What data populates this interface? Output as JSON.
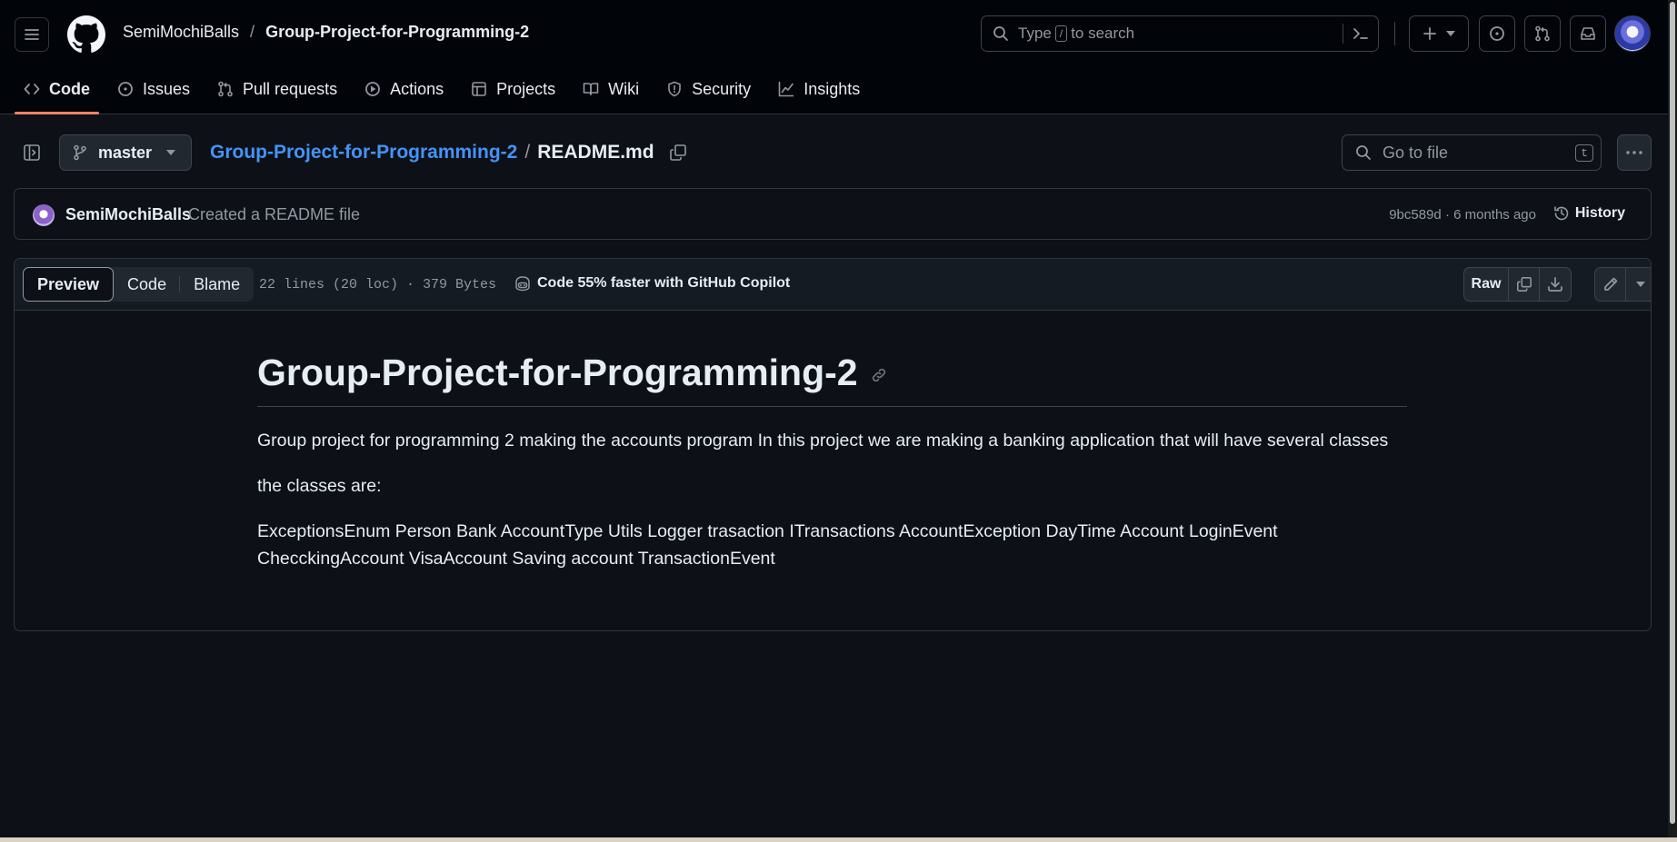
{
  "header": {
    "owner": "SemiMochiBalls",
    "separator": "/",
    "repo": "Group-Project-for-Programming-2",
    "search": {
      "prefix": "Type",
      "key": "/",
      "suffix": "to search"
    },
    "icons": {
      "menu": "hamburger-icon",
      "logo": "github-logo-icon",
      "command": "command-palette-icon",
      "create": "plus-icon",
      "issues": "issue-opened-icon",
      "pulls": "git-pull-request-icon",
      "inbox": "inbox-icon"
    }
  },
  "tabs": [
    {
      "label": "Code",
      "icon": "code-icon",
      "active": true
    },
    {
      "label": "Issues",
      "icon": "issue-opened-icon"
    },
    {
      "label": "Pull requests",
      "icon": "git-pull-request-icon"
    },
    {
      "label": "Actions",
      "icon": "play-icon"
    },
    {
      "label": "Projects",
      "icon": "table-icon"
    },
    {
      "label": "Wiki",
      "icon": "book-icon"
    },
    {
      "label": "Security",
      "icon": "shield-icon"
    },
    {
      "label": "Insights",
      "icon": "graph-icon"
    }
  ],
  "filenav": {
    "branch": "master",
    "repo_link": "Group-Project-for-Programming-2",
    "separator": "/",
    "file": "README.md",
    "goto_placeholder": "Go to file",
    "goto_key": "t"
  },
  "commit": {
    "author": "SemiMochiBalls",
    "message": "Created a README file",
    "meta": "9bc589d · 6 months ago",
    "history_label": "History"
  },
  "filebar": {
    "views": [
      "Preview",
      "Code",
      "Blame"
    ],
    "info": "22 lines (20 loc) · 379 Bytes",
    "copilot": "Code 55% faster with GitHub Copilot",
    "raw": "Raw"
  },
  "readme": {
    "title": "Group-Project-for-Programming-2",
    "p1": "Group project for programming 2 making the accounts program In this project we are making a banking application that will have several classes",
    "p2": "the classes are:",
    "p3": "ExceptionsEnum Person Bank AccountType Utils Logger trasaction ITransactions AccountException DayTime Account LoginEvent ChecckingAccount VisaAccount Saving account TransactionEvent"
  },
  "colors": {
    "background": "#0d1117",
    "header": "#010409",
    "link": "#4493f8",
    "active_tab_underline": "#f78166",
    "muted": "#9198a1"
  }
}
